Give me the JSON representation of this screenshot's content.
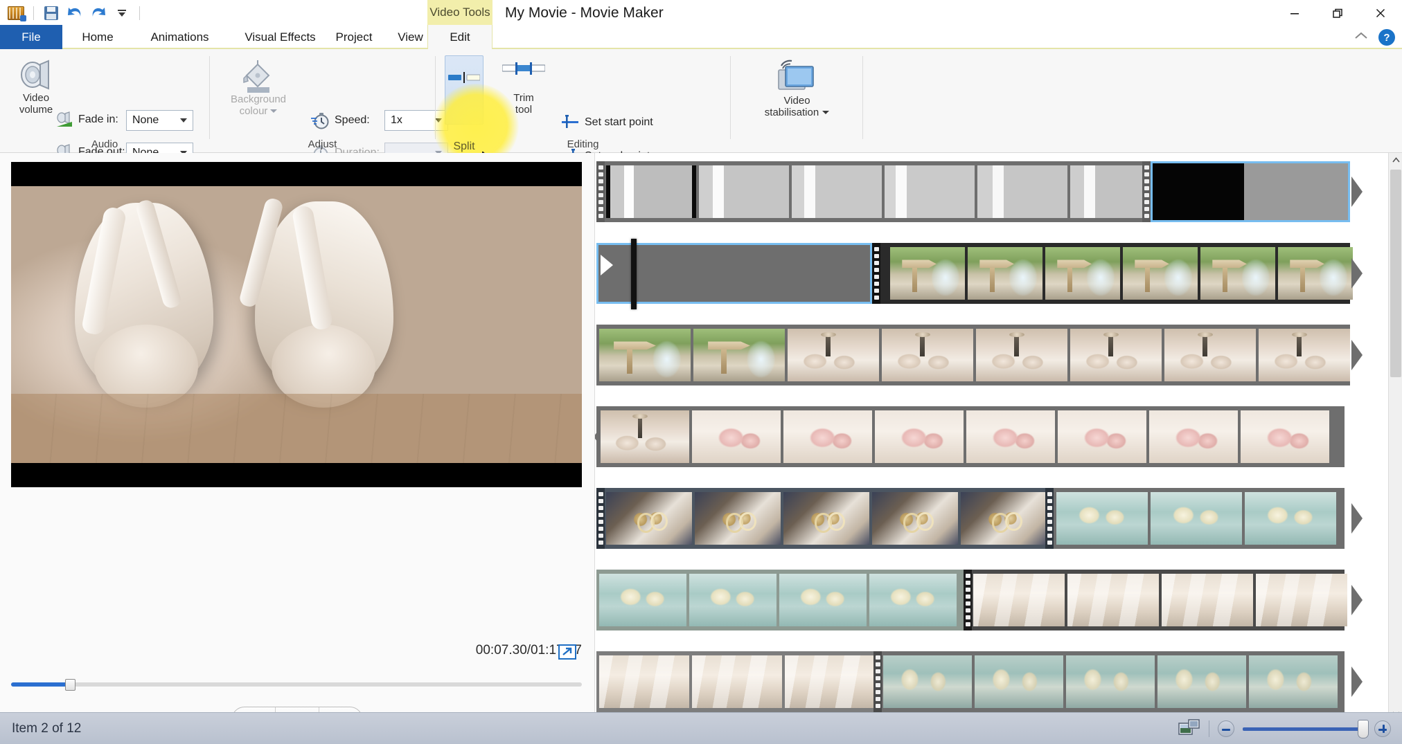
{
  "window": {
    "title": "My Movie - Movie Maker",
    "contextual_tab_group": "Video Tools",
    "minimize_label": "Minimize",
    "restore_label": "Restore",
    "close_label": "Close"
  },
  "quick_access": {
    "app_icon": "movie-maker-icon",
    "items": [
      {
        "name": "save-icon",
        "label": "Save"
      },
      {
        "name": "undo-icon",
        "label": "Undo"
      },
      {
        "name": "redo-icon",
        "label": "Redo"
      },
      {
        "name": "customize-qat-icon",
        "label": "Customize Quick Access Toolbar"
      }
    ]
  },
  "tabs": [
    {
      "label": "File",
      "state": "file"
    },
    {
      "label": "Home",
      "state": "normal"
    },
    {
      "label": "Animations",
      "state": "normal"
    },
    {
      "label": "Visual Effects",
      "state": "normal"
    },
    {
      "label": "Project",
      "state": "normal"
    },
    {
      "label": "View",
      "state": "normal"
    },
    {
      "label": "Edit",
      "state": "active"
    }
  ],
  "ribbon_right": {
    "collapse_label": "Collapse the Ribbon",
    "help_label": "?"
  },
  "ribbon": {
    "groups": [
      {
        "label": "Audio"
      },
      {
        "label": "Adjust"
      },
      {
        "label": "Editing"
      }
    ],
    "audio": {
      "video_volume_line1": "Video",
      "video_volume_line2": "volume",
      "fade_in_label": "Fade in:",
      "fade_in_value": "None",
      "fade_out_label": "Fade out:",
      "fade_out_value": "None"
    },
    "adjust": {
      "background_colour_line1": "Background",
      "background_colour_line2": "colour",
      "speed_label": "Speed:",
      "speed_value": "1x",
      "duration_label": "Duration:",
      "duration_value": ""
    },
    "editing": {
      "split_label": "Split",
      "trim_tool_line1": "Trim",
      "trim_tool_line2": "tool",
      "set_start_point_label": "Set start point",
      "set_end_point_label": "Set end point"
    },
    "stabilisation": {
      "line1": "Video",
      "line2": "stabilisation"
    }
  },
  "preview": {
    "timecode": "00:07.30/01:17.17",
    "fullscreen_label": "View full screen",
    "transport": [
      {
        "name": "previous-frame-button",
        "label": "Previous frame"
      },
      {
        "name": "play-button",
        "label": "Play"
      },
      {
        "name": "next-frame-button",
        "label": "Next frame"
      }
    ],
    "scrub_percent": 9.5
  },
  "timeline": {
    "rows": [
      {
        "row": 1,
        "kind": "video-clip",
        "thumbnail_theme": "bride-dress-white",
        "selected_clip_at_end": true,
        "frames": 7
      },
      {
        "row": 2,
        "kind": "video-clip",
        "thumbnail_theme": "wedding-sign-fountain",
        "selected_clip": true,
        "playhead_visible": true,
        "frames": 6
      },
      {
        "row": 3,
        "kind": "video-clip",
        "thumbnail_theme": "wedding-sign-and-table-setting",
        "frames": 8
      },
      {
        "row": 4,
        "kind": "video-clip",
        "thumbnail_theme": "table-setting-pink-roses",
        "frames": 8
      },
      {
        "row": 5,
        "kind": "video-clip",
        "thumbnail_theme": "wedding-rings-and-bouquets",
        "frames": 8
      },
      {
        "row": 6,
        "kind": "video-clip",
        "thumbnail_theme": "bridesmaids-to-dress",
        "frames": 8
      },
      {
        "row": 7,
        "kind": "video-clip",
        "thumbnail_theme": "dress-and-bridesmaids",
        "frames": 8
      }
    ]
  },
  "status": {
    "item_text": "Item 2 of 12",
    "project_view_icon": "storyboard-toggle-icon",
    "zoom_out_label": "Zoom out",
    "zoom_in_label": "Zoom in",
    "zoom_value_percent": 96
  },
  "colors": {
    "accent_blue": "#1f5fb0",
    "contextual_yellow": "#f2eeab",
    "selection_blue": "#77bdf0",
    "highlight_glow": "#ffee3c",
    "ribbon_bg": "#f7f7f7",
    "statusbar_bg": "#bfc7d3"
  }
}
